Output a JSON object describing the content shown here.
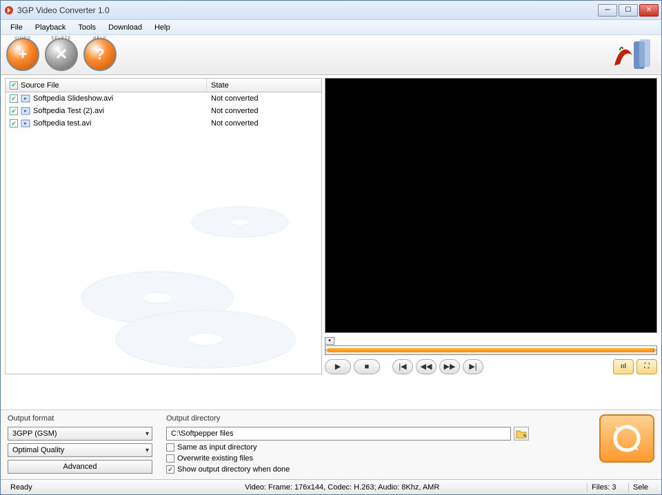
{
  "title": "3GP Video Converter 1.0",
  "menu": [
    "File",
    "Playback",
    "Tools",
    "Download",
    "Help"
  ],
  "toolbar": {
    "video": "VIDEO",
    "delete": "DELETE",
    "help": "HELP"
  },
  "table": {
    "headers": {
      "source": "Source File",
      "state": "State"
    },
    "rows": [
      {
        "file": "Softpedia Slideshow.avi",
        "state": "Not converted",
        "checked": true
      },
      {
        "file": "Softpedia Test (2).avi",
        "state": "Not converted",
        "checked": true
      },
      {
        "file": "Softpedia test.avi",
        "state": "Not converted",
        "checked": true
      }
    ]
  },
  "output": {
    "format_label": "Output format",
    "format": "3GPP (GSM)",
    "quality": "Optimal Quality",
    "advanced": "Advanced",
    "dir_label": "Output directory",
    "dir": "C:\\Softpepper files",
    "same_as_input": "Same as input directory",
    "overwrite": "Overwrite existing files",
    "show_output": "Show output directory when done",
    "same_checked": false,
    "overwrite_checked": false,
    "show_checked": true
  },
  "status": {
    "ready": "Ready",
    "video_info": "Video: Frame: 176x144, Codec: H.263; Audio: 8Khz, AMR",
    "files": "Files: 3",
    "selected": "Sele"
  }
}
